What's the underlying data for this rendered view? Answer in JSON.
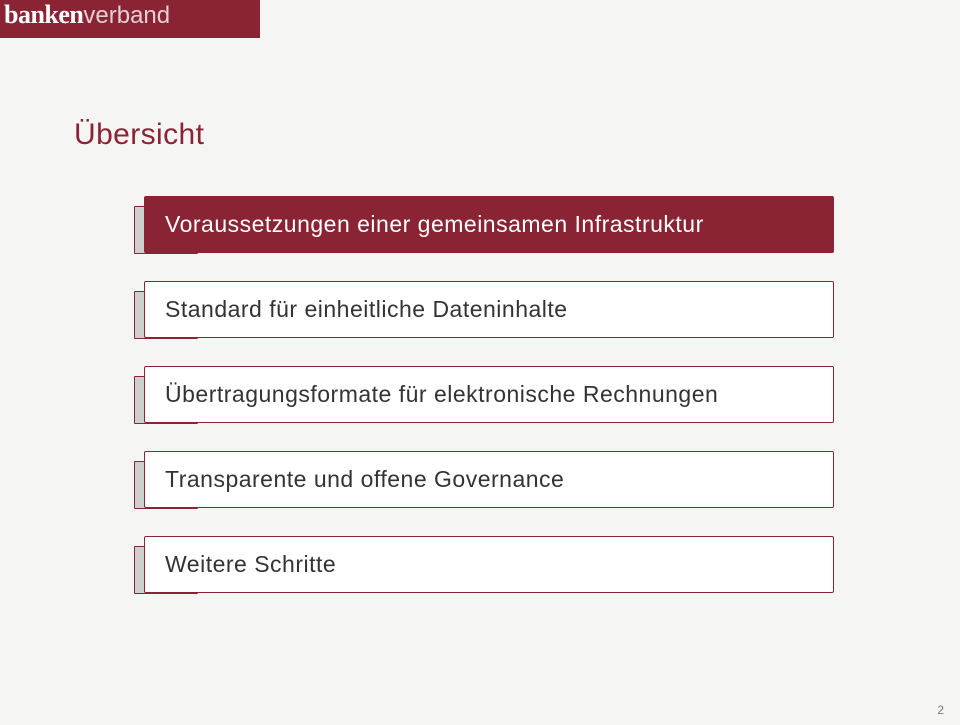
{
  "header": {
    "logo_bold": "banken",
    "logo_light": "verband"
  },
  "title": "Übersicht",
  "tracks": [
    {
      "label": "Voraussetzungen einer gemeinsamen Infrastruktur"
    },
    {
      "label": "Standard für einheitliche Dateninhalte"
    },
    {
      "label": "Übertragungsformate für elektronische Rechnungen"
    },
    {
      "label": "Transparente und offene Governance"
    },
    {
      "label": "Weitere Schritte"
    }
  ],
  "page_number": "2"
}
